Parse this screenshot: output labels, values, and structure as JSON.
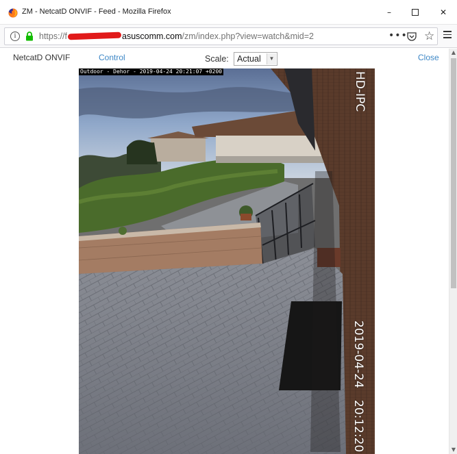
{
  "window": {
    "title": "ZM - NetcatD ONVIF - Feed - Mozilla Firefox",
    "minimize_glyph": "–",
    "close_glyph": "✕"
  },
  "addressbar": {
    "url_scheme": "https://f",
    "url_host": "asuscomm.com",
    "url_path": "/zm/index.php?view=watch&mid=2",
    "info_glyph": "i",
    "more_glyph": "•••",
    "star_glyph": "☆"
  },
  "icons": {
    "browser": "firefox-logo",
    "site_info": "info-icon",
    "lock": "lock-icon",
    "page_actions": "more-icon",
    "pocket": "pocket-icon",
    "bookmark": "star-icon",
    "menu": "hamburger-icon"
  },
  "colors": {
    "link": "#3d87c6",
    "lock_green": "#12bc00",
    "redaction": "#e11a1a"
  },
  "toolbar": {
    "monitor_name": "NetcatD ONVIF",
    "control_label": "Control",
    "scale_label": "Scale:",
    "scale_value": "Actual",
    "close_label": "Close"
  },
  "feed": {
    "osd_top": "Outdoor - Dehor - 2019-04-24 20:21:07 +0200",
    "osd_model": "HD-IPC",
    "osd_date": "2019-04-24",
    "osd_time": "20:12:20"
  },
  "scrollbar": {
    "up_glyph": "▲",
    "down_glyph": "▼"
  }
}
